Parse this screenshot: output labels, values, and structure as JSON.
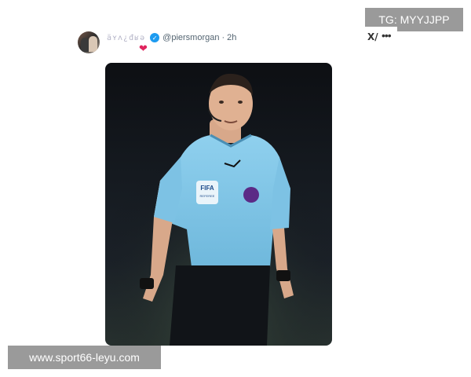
{
  "watermark_top": "TG: MYYJJPP",
  "watermark_bottom": "www.sport66-leyu.com",
  "tweet": {
    "display_name": "äʏʌ¿đʁə",
    "handle": "@piersmorgan",
    "separator": "·",
    "time": "2h",
    "reaction_icon": "heart-icon",
    "grok_icon": "grok-icon",
    "more_icon": "more-icon",
    "heart_color": "#e0245e",
    "verified_color": "#1d9bf0",
    "photo": {
      "badge_text": "FIFA",
      "badge_subtext": "REFEREE",
      "jersey_color": "#79c3e6"
    }
  }
}
